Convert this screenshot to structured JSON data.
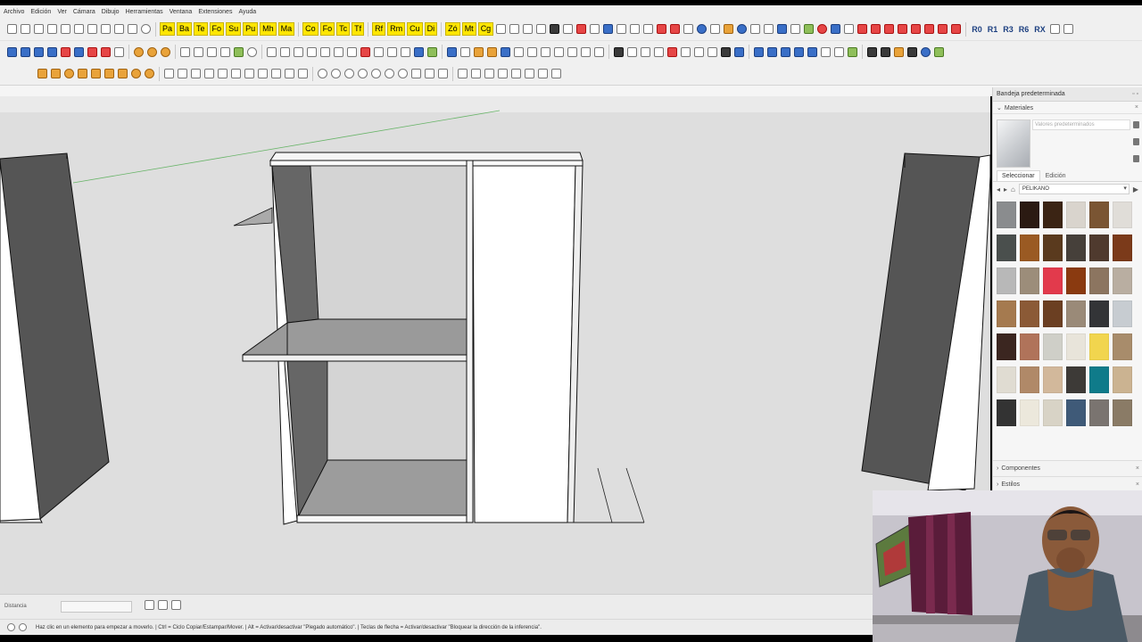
{
  "menu": [
    "Archivo",
    "Edición",
    "Ver",
    "Cámara",
    "Dibujo",
    "Herramientas",
    "Ventana",
    "Extensiones",
    "Ayuda"
  ],
  "toolbar_labels": [
    "Pa",
    "Ba",
    "Te",
    "Fo",
    "Su",
    "Pu",
    "Mh",
    "Ma",
    "Co",
    "Fo",
    "Tc",
    "Tf",
    "Rf",
    "Rm",
    "Cu",
    "Di",
    "Zó",
    "Mt",
    "Cg"
  ],
  "rotation_labels": [
    "R0",
    "R1",
    "R3",
    "R6",
    "RX"
  ],
  "tray": {
    "title": "Bandeja predeterminada",
    "materials_label": "Materiales",
    "material_name_placeholder": "Valores predeterminados",
    "tab_select": "Seleccionar",
    "tab_edit": "Edición",
    "library": "PELIKANO",
    "swatch_colors": [
      "#8a8c8e",
      "#2b1a12",
      "#3b2414",
      "#d9d4cd",
      "#7a5533",
      "#e0ddd8",
      "#4a4f4d",
      "#9a5a23",
      "#5a3a1e",
      "#46403a",
      "#4f3a2e",
      "#7b3a1a",
      "#b8b8b8",
      "#9c8d7a",
      "#e23a4c",
      "#8a3a10",
      "#8c7560",
      "#b9aea1",
      "#a57a4f",
      "#8b5a36",
      "#6b3f22",
      "#9a8a78",
      "#333437",
      "#c7ccd1",
      "#3b2620",
      "#b0735a",
      "#cfcfc8",
      "#e8e4da",
      "#f1d54e",
      "#a88c6b",
      "#e0dcd2",
      "#b08968",
      "#d2b89b",
      "#3d3a37",
      "#0f7b8a",
      "#cbb391",
      "#333333",
      "#ece8dc",
      "#d8d3c6",
      "#3f5a78",
      "#7a7470",
      "#8a7b66",
      "#3a3330",
      "#5a3e2a",
      "#a68a6a",
      "#e4e2dc",
      "#2c2c2c",
      "#9a8a76"
    ],
    "components_label": "Componentes",
    "styles_label": "Estilos"
  },
  "measure": {
    "label": "Distancia",
    "value": ""
  },
  "status": {
    "text": "Haz clic en un elemento para empezar a moverlo. | Ctrl = Ciclo Copiar/Estampar/Mover. | Alt = Activar/desactivar \"Plegado automático\". | Teclas de flecha = Activar/desactivar \"Bloquear la dirección de la inferencia\"."
  }
}
